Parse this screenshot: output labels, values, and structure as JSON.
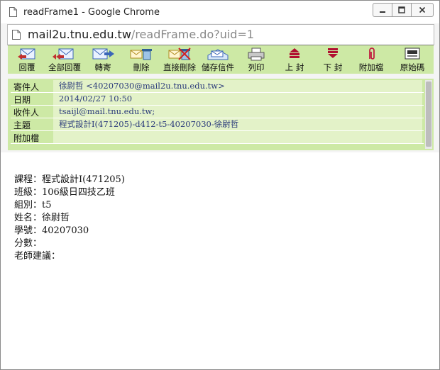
{
  "window": {
    "title": "readFrame1 - Google Chrome"
  },
  "address": {
    "host": "mail2u.tnu.edu.tw",
    "path": "/readFrame.do?uid=1"
  },
  "toolbar": {
    "buttons": [
      {
        "label": "回覆",
        "icon": "reply-icon"
      },
      {
        "label": "全部回覆",
        "icon": "reply-all-icon"
      },
      {
        "label": "轉寄",
        "icon": "forward-icon"
      },
      {
        "label": "刪除",
        "icon": "delete-icon"
      },
      {
        "label": "直接刪除",
        "icon": "delete-direct-icon"
      },
      {
        "label": "儲存信件",
        "icon": "save-mail-icon"
      },
      {
        "label": "列印",
        "icon": "print-icon"
      },
      {
        "label": "上 封",
        "icon": "previous-icon"
      },
      {
        "label": "下 封",
        "icon": "next-icon"
      },
      {
        "label": "附加檔",
        "icon": "attachment-icon"
      },
      {
        "label": "原始碼",
        "icon": "source-icon"
      }
    ]
  },
  "header": {
    "rows": [
      {
        "label": "寄件人",
        "value": "徐尉哲 <40207030@mail2u.tnu.edu.tw>"
      },
      {
        "label": "日期",
        "value": "2014/02/27 10:50"
      },
      {
        "label": "收件人",
        "value": "tsaijl@mail.tnu.edu.tw;"
      },
      {
        "label": "主題",
        "value": "程式設計I(471205)-d412-t5-40207030-徐尉哲"
      },
      {
        "label": "附加檔",
        "value": ""
      }
    ]
  },
  "body": {
    "lines": [
      " 課程：程式設計I(471205)",
      "班級：106級日四技乙班",
      "組別：t5",
      "姓名：徐尉哲",
      "學號：40207030",
      "分數：",
      "老師建議："
    ]
  },
  "colors": {
    "toolbar_bg": "#cde9a5",
    "header_value_bg": "#e3f2c8",
    "header_value_text": "#2a3a7a"
  }
}
